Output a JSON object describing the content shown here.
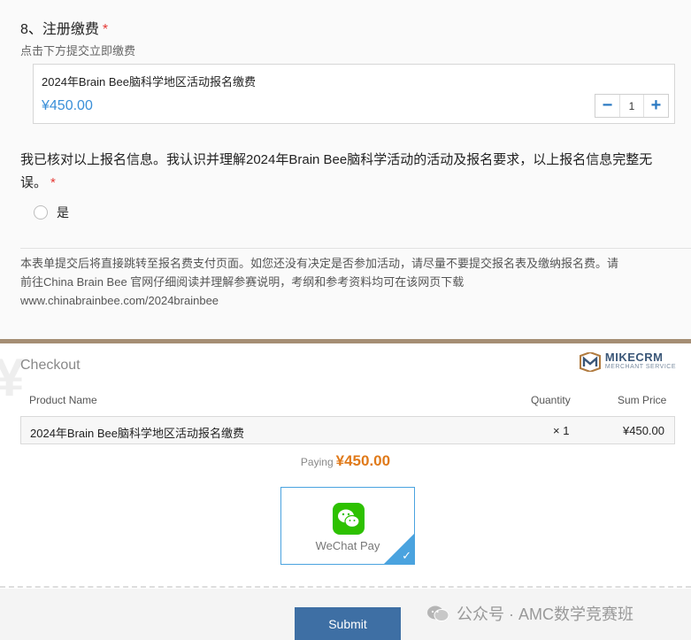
{
  "question": {
    "title": "8、注册缴费",
    "required_mark": "*",
    "description": "点击下方提交立即缴费"
  },
  "product": {
    "name": "2024年Brain Bee脑科学地区活动报名缴费",
    "price": "¥450.00",
    "quantity": "1",
    "minus": "−",
    "plus": "+"
  },
  "confirm": {
    "text": "我已核对以上报名信息。我认识并理解2024年Brain Bee脑科学活动的活动及报名要求，以上报名信息完整无误。",
    "required_mark": "*",
    "option_label": "是"
  },
  "notice": {
    "line1": "本表单提交后将直接跳转至报名费支付页面。如您还没有决定是否参加活动，请尽量不要提交报名表及缴纳报名费。请",
    "line2": "前往China Brain Bee 官网仔细阅读并理解参赛说明，考纲和参考资料均可在该网页下载",
    "line3": "www.chinabrainbee.com/2024brainbee"
  },
  "checkout": {
    "watermark": "¥",
    "title": "Checkout",
    "logo_main": "MIKECRM",
    "logo_sub": "MERCHANT SERVICE",
    "headers": {
      "product": "Product Name",
      "quantity": "Quantity",
      "sum": "Sum Price"
    },
    "row": {
      "product": "2024年Brain Bee脑科学地区活动报名缴费",
      "quantity": "× 1",
      "sum": "¥450.00"
    },
    "paying_label": "Paying",
    "paying_amount": "¥450.00",
    "payment_method": "WeChat Pay",
    "submit_label": "Submit"
  },
  "watermark": {
    "text": "公众号 · AMC数学竞赛班"
  },
  "colors": {
    "accent": "#3a8fd8",
    "amount": "#e07a1a",
    "submit": "#3e6fa4",
    "wechat": "#2dc100"
  }
}
